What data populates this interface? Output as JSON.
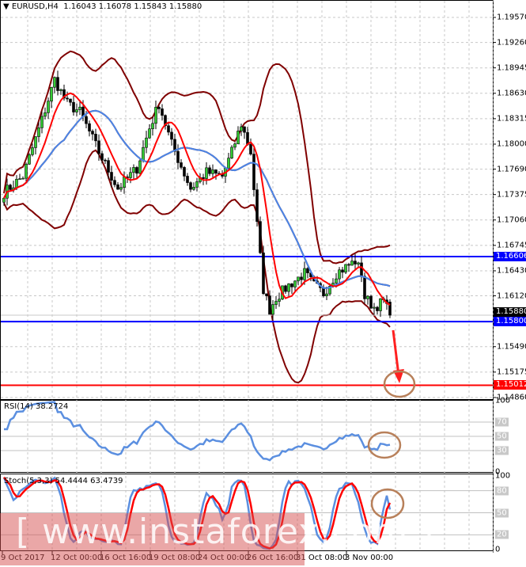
{
  "header": {
    "symbol": "EURUSD,H4",
    "ohlc": "1.16043 1.16078 1.15843 1.15880"
  },
  "price_axis": [
    "1.19570",
    "1.19260",
    "1.18945",
    "1.18630",
    "1.18315",
    "1.18000",
    "1.17690",
    "1.17375",
    "1.17060",
    "1.16745",
    "1.16430",
    "1.16120",
    "1.15490",
    "1.15175",
    "1.14860"
  ],
  "levels": [
    {
      "value": 1.16606,
      "label": "1.16606",
      "color": "#0000ff"
    },
    {
      "value": 1.158,
      "label": "1.15800",
      "color": "#0000ff"
    },
    {
      "value": 1.15012,
      "label": "1.15012",
      "color": "#ff0000"
    }
  ],
  "current_price": {
    "value": 1.1588,
    "label": "1.15880",
    "color": "#000000"
  },
  "rsi": {
    "title": "RSI(14) 38.2724",
    "levels": [
      "100",
      "70",
      "50",
      "30",
      "0"
    ]
  },
  "stoch": {
    "title": "Stoch(5,3,3) 54.4444 63.4739",
    "levels": [
      "100",
      "80",
      "50",
      "20",
      "0"
    ]
  },
  "time_axis": [
    "9 Oct 2017",
    "12 Oct 00:00",
    "16 Oct 16:00",
    "19 Oct 08:00",
    "24 Oct 00:00",
    "26 Oct 16:00",
    "31 Oct 08:00",
    "3 Nov 00:00"
  ],
  "watermark": "[ www.instaforex.com ]",
  "colors": {
    "bull": "#33cc33",
    "bear": "#000000",
    "bands": "#800000",
    "ma_fast": "#ff0000",
    "ma_slow": "#4a86e8",
    "rsi": "#5b8fe0",
    "stoch_k": "#5b8fe0",
    "stoch_d": "#ff0000",
    "annotation": "#b8805a"
  },
  "chart_data": {
    "type": "candlestick",
    "instrument": "EURUSD",
    "timeframe": "H4",
    "close_keypoints": [
      [
        0,
        1.174
      ],
      [
        6,
        1.176
      ],
      [
        12,
        1.183
      ],
      [
        16,
        1.188
      ],
      [
        20,
        1.185
      ],
      [
        24,
        1.184
      ],
      [
        30,
        1.179
      ],
      [
        36,
        1.1745
      ],
      [
        42,
        1.177
      ],
      [
        46,
        1.182
      ],
      [
        49,
        1.185
      ],
      [
        53,
        1.18
      ],
      [
        59,
        1.1745
      ],
      [
        64,
        1.1765
      ],
      [
        69,
        1.176
      ],
      [
        72,
        1.179
      ],
      [
        75,
        1.1825
      ],
      [
        78,
        1.179
      ],
      [
        80,
        1.17
      ],
      [
        82,
        1.162
      ],
      [
        84,
        1.1595
      ],
      [
        86,
        1.161
      ],
      [
        90,
        1.1625
      ],
      [
        95,
        1.164
      ],
      [
        98,
        1.1625
      ],
      [
        101,
        1.1615
      ],
      [
        105,
        1.164
      ],
      [
        109,
        1.165
      ],
      [
        111,
        1.1655
      ],
      [
        113,
        1.164
      ],
      [
        114,
        1.161
      ],
      [
        117,
        1.1598
      ],
      [
        120,
        1.1605
      ],
      [
        122,
        1.1588
      ]
    ]
  }
}
